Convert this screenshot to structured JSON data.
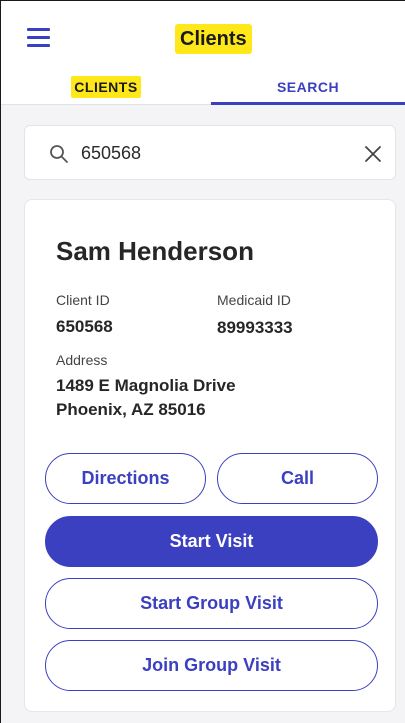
{
  "header": {
    "title": "Clients",
    "menu_icon": "hamburger-menu-icon",
    "accent_color": "#3b40c0",
    "highlight_color": "#ffe81a"
  },
  "tabs": [
    {
      "label": "CLIENTS",
      "active": false
    },
    {
      "label": "SEARCH",
      "active": true
    }
  ],
  "search": {
    "icon": "search-icon",
    "value": "650568",
    "clear_icon": "close-icon"
  },
  "client": {
    "name": "Sam Henderson",
    "client_id_label": "Client ID",
    "client_id": "650568",
    "medicaid_id_label": "Medicaid ID",
    "medicaid_id": "89993333",
    "address_label": "Address",
    "address_line1": "1489 E Magnolia Drive",
    "address_line2": "Phoenix, AZ 85016"
  },
  "actions": {
    "directions": "Directions",
    "call": "Call",
    "start_visit": "Start Visit",
    "start_group_visit": "Start Group Visit",
    "join_group_visit": "Join Group Visit"
  }
}
